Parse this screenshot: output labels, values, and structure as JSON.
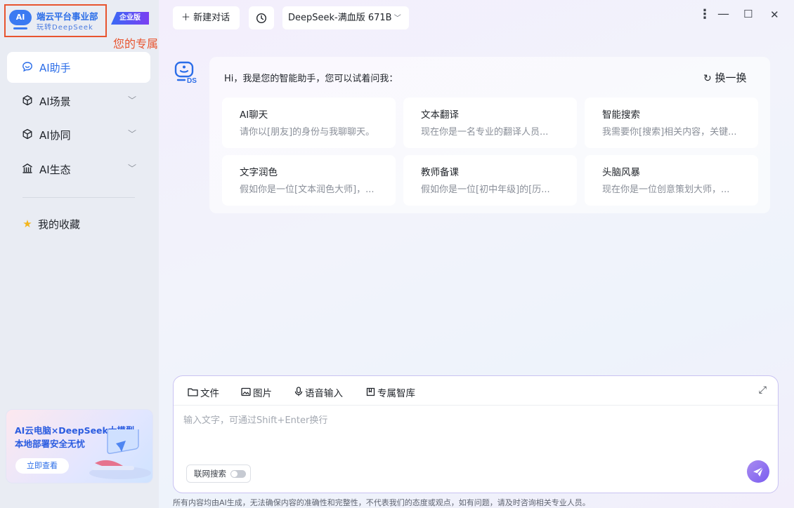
{
  "brand": {
    "logo_icon_text": "AI",
    "title": "端云平台事业部",
    "subtitle": "玩转DeepSeek",
    "edition_badge": "企业版",
    "logo_note": "您的专属logo"
  },
  "sidebar": {
    "items": [
      {
        "label": "AI助手",
        "icon": "chat-bubble-icon",
        "glyph": "☺",
        "active": true,
        "expandable": false
      },
      {
        "label": "AI场景",
        "icon": "cube-icon",
        "glyph": "⬡",
        "active": false,
        "expandable": true
      },
      {
        "label": "AI协同",
        "icon": "cube-icon",
        "glyph": "⬡",
        "active": false,
        "expandable": true
      },
      {
        "label": "AI生态",
        "icon": "building-icon",
        "glyph": "⌂",
        "active": false,
        "expandable": true
      }
    ],
    "favorites": {
      "label": "我的收藏",
      "icon": "star-icon",
      "glyph": "★"
    },
    "promo": {
      "line1": "AI云电脑×DeepSeek大模型",
      "line2": "本地部署安全无忧",
      "button": "立即查看"
    }
  },
  "topbar": {
    "new_chat": "＋ 新建对话",
    "history_icon": "clock-icon",
    "model": "DeepSeek-满血版 671B",
    "window": {
      "more": "⋮",
      "minimize": "—",
      "maximize": "☐",
      "close": "✕"
    }
  },
  "prompts": {
    "greeting": "Hi，我是您的智能助手，您可以试着问我：",
    "refresh": "换一换",
    "cards": [
      {
        "title": "AI聊天",
        "desc": "请你以[朋友]的身份与我聊聊天。"
      },
      {
        "title": "文本翻译",
        "desc": "现在你是一名专业的翻译人员..."
      },
      {
        "title": "智能搜索",
        "desc": "我需要你[搜索]相关内容，关键..."
      },
      {
        "title": "文字润色",
        "desc": "假如你是一位[文本润色大师]，..."
      },
      {
        "title": "教师备课",
        "desc": "假如你是一位[初中年级]的[历..."
      },
      {
        "title": "头脑风暴",
        "desc": "现在你是一位创意策划大师，..."
      }
    ]
  },
  "composer": {
    "tools": [
      {
        "label": "文件",
        "icon": "folder-icon",
        "glyph": "🗀"
      },
      {
        "label": "图片",
        "icon": "image-icon",
        "glyph": "▧"
      },
      {
        "label": "语音输入",
        "icon": "microphone-icon",
        "glyph": "🎙"
      },
      {
        "label": "专属智库",
        "icon": "book-icon",
        "glyph": "⊓"
      }
    ],
    "placeholder": "输入文字，可通过Shift+Enter换行",
    "value": "",
    "web_search_label": "联网搜索",
    "web_search_on": false
  },
  "footer": {
    "disclaimer": "所有内容均由AI生成，无法确保内容的准确性和完整性，不代表我们的态度或观点，如有问题，请及时咨询相关专业人员。"
  }
}
